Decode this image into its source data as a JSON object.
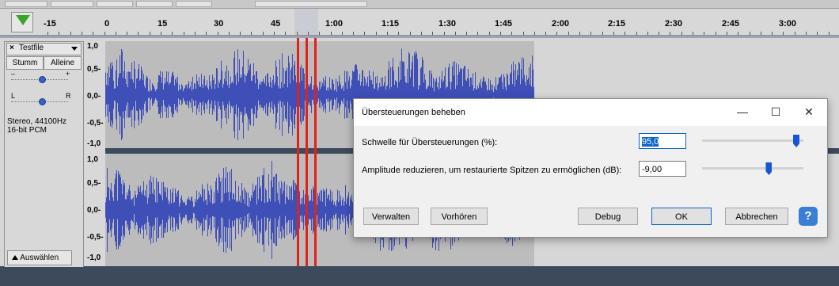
{
  "ruler": {
    "ticks": [
      "-15",
      "0",
      "15",
      "30",
      "45",
      "1:00",
      "1:15",
      "1:30",
      "1:45",
      "2:00",
      "2:15",
      "2:30",
      "2:45",
      "3:00"
    ]
  },
  "track": {
    "close_label": "×",
    "name": "Testfile",
    "menu_icon": "triangle-down-icon",
    "mute_label": "Stumm",
    "solo_label": "Alleine",
    "gain_minus": "–",
    "gain_plus": "+",
    "pan_left": "L",
    "pan_right": "R",
    "info_line1": "Stereo, 44100Hz",
    "info_line2": "16-bit PCM",
    "select_label": "Auswählen"
  },
  "scale": {
    "channel1": [
      "1,0",
      "0,5-",
      "0,0-",
      "-0,5-",
      "-1,0"
    ],
    "channel2": [
      "1,0",
      "0,5-",
      "0,0-",
      "-0,5-",
      "-1,0"
    ]
  },
  "dialog": {
    "title": "Übersteuerungen beheben",
    "threshold_label": "Schwelle für Übersteuerungen (%):",
    "threshold_value": "95,0",
    "amplitude_label": "Amplitude reduzieren, um restaurierte Spitzen zu ermöglichen (dB):",
    "amplitude_value": "-9,00",
    "threshold_slider": 0.93,
    "amplitude_slider": 0.66,
    "buttons": {
      "manage": "Verwalten",
      "preview": "Vorhören",
      "debug": "Debug",
      "ok": "OK",
      "cancel": "Abbrechen",
      "help": "?"
    },
    "window_controls": {
      "minimize": "—",
      "maximize": "☐",
      "close": "✕"
    }
  },
  "colors": {
    "waveform": "#3f4fb8",
    "clip_marker": "#e2211b",
    "accent": "#0a64c8"
  }
}
